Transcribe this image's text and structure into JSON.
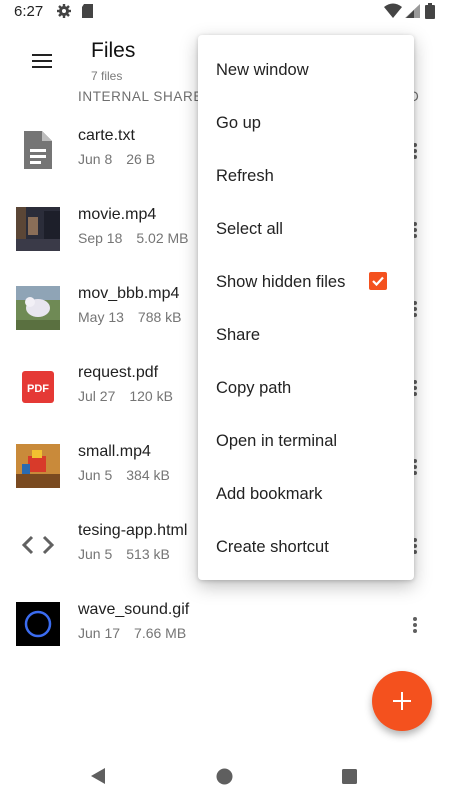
{
  "status_bar": {
    "time": "6:27",
    "icons": [
      "gear-icon",
      "sd-card-icon",
      "wifi-icon",
      "signal-icon",
      "battery-icon"
    ]
  },
  "app_bar": {
    "title": "Files",
    "subtitle": "7 files",
    "menu_icon": "hamburger-menu-icon"
  },
  "breadcrumb": {
    "text": "INTERNAL SHARE",
    "right_fragment": "D"
  },
  "files": [
    {
      "name": "carte.txt",
      "date": "Jun 8",
      "size": "26 B",
      "thumb": "text-file-icon"
    },
    {
      "name": "movie.mp4",
      "date": "Sep 18",
      "size": "5.02 MB",
      "thumb": "video-thumbnail"
    },
    {
      "name": "mov_bbb.mp4",
      "date": "May 13",
      "size": "788 kB",
      "thumb": "video-thumbnail"
    },
    {
      "name": "request.pdf",
      "date": "Jul 27",
      "size": "120 kB",
      "thumb": "pdf-icon"
    },
    {
      "name": "small.mp4",
      "date": "Jun 5",
      "size": "384 kB",
      "thumb": "video-thumbnail"
    },
    {
      "name": "tesing-app.html",
      "date": "Jun 5",
      "size": "513 kB",
      "thumb": "code-icon"
    },
    {
      "name": "wave_sound.gif",
      "date": "Jun 17",
      "size": "7.66 MB",
      "thumb": "gif-thumbnail"
    }
  ],
  "overflow_menu": {
    "items": [
      {
        "label": "New window"
      },
      {
        "label": "Go up"
      },
      {
        "label": "Refresh"
      },
      {
        "label": "Select all"
      },
      {
        "label": "Show hidden files",
        "checked": true
      },
      {
        "label": "Share"
      },
      {
        "label": "Copy path"
      },
      {
        "label": "Open in terminal"
      },
      {
        "label": "Add bookmark"
      },
      {
        "label": "Create shortcut"
      }
    ]
  },
  "fab": {
    "icon": "plus-icon"
  },
  "nav_bar": {
    "icons": [
      "back-icon",
      "home-icon",
      "recents-icon"
    ]
  },
  "colors": {
    "accent": "#f4511e",
    "pdf_red": "#e53935"
  }
}
